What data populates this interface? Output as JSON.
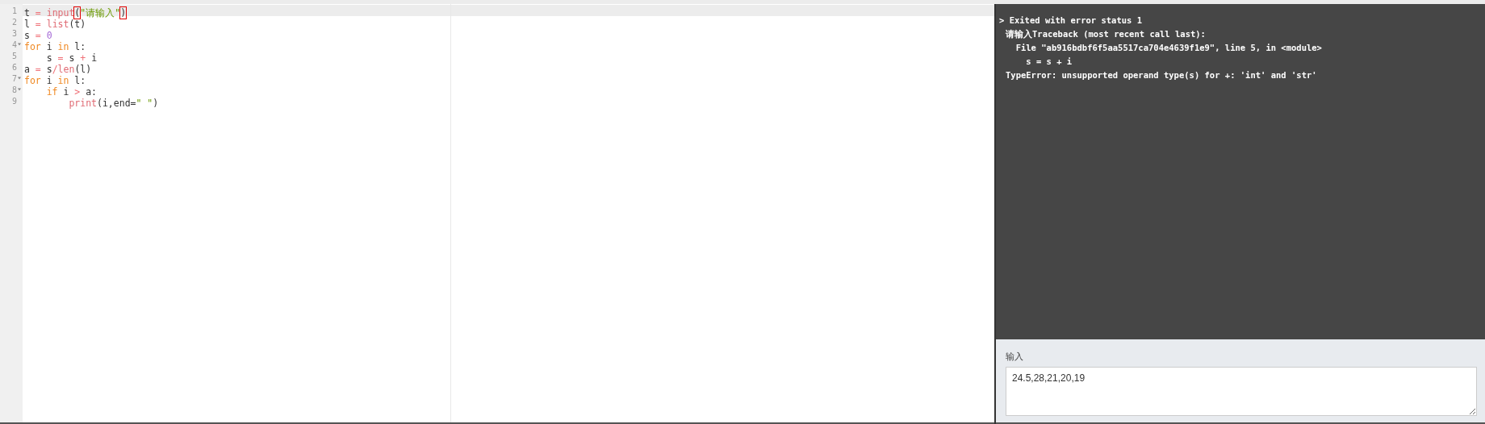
{
  "editor": {
    "lines": [
      {
        "number": "1",
        "active": true,
        "foldable": false,
        "tokens": [
          {
            "text": "t",
            "kind": "plain"
          },
          {
            "text": " = ",
            "kind": "operator"
          },
          {
            "text": "input",
            "kind": "builtin"
          },
          {
            "text": "(",
            "kind": "bracket-match"
          },
          {
            "text": "\"请输入\"",
            "kind": "string"
          },
          {
            "text": ")",
            "kind": "bracket-match"
          }
        ]
      },
      {
        "number": "2",
        "active": false,
        "foldable": false,
        "tokens": [
          {
            "text": "l",
            "kind": "plain"
          },
          {
            "text": " = ",
            "kind": "operator"
          },
          {
            "text": "list",
            "kind": "builtin"
          },
          {
            "text": "(t)",
            "kind": "plain"
          }
        ]
      },
      {
        "number": "3",
        "active": false,
        "foldable": false,
        "tokens": [
          {
            "text": "s",
            "kind": "plain"
          },
          {
            "text": " = ",
            "kind": "operator"
          },
          {
            "text": "0",
            "kind": "number"
          }
        ]
      },
      {
        "number": "4",
        "active": false,
        "foldable": true,
        "tokens": [
          {
            "text": "for",
            "kind": "keyword"
          },
          {
            "text": " i ",
            "kind": "plain"
          },
          {
            "text": "in",
            "kind": "keyword"
          },
          {
            "text": " l:",
            "kind": "plain"
          }
        ]
      },
      {
        "number": "5",
        "active": false,
        "foldable": false,
        "tokens": [
          {
            "text": "    s",
            "kind": "plain"
          },
          {
            "text": " = ",
            "kind": "operator"
          },
          {
            "text": "s",
            "kind": "plain"
          },
          {
            "text": " + ",
            "kind": "operator"
          },
          {
            "text": "i",
            "kind": "plain"
          }
        ]
      },
      {
        "number": "6",
        "active": false,
        "foldable": false,
        "tokens": [
          {
            "text": "a",
            "kind": "plain"
          },
          {
            "text": " = ",
            "kind": "operator"
          },
          {
            "text": "s",
            "kind": "plain"
          },
          {
            "text": "/",
            "kind": "operator"
          },
          {
            "text": "len",
            "kind": "builtin"
          },
          {
            "text": "(l)",
            "kind": "plain"
          }
        ]
      },
      {
        "number": "7",
        "active": false,
        "foldable": true,
        "tokens": [
          {
            "text": "for",
            "kind": "keyword"
          },
          {
            "text": " i ",
            "kind": "plain"
          },
          {
            "text": "in",
            "kind": "keyword"
          },
          {
            "text": " l:",
            "kind": "plain"
          }
        ]
      },
      {
        "number": "8",
        "active": false,
        "foldable": true,
        "tokens": [
          {
            "text": "    if",
            "kind": "keyword"
          },
          {
            "text": " i ",
            "kind": "plain"
          },
          {
            "text": ">",
            "kind": "operator"
          },
          {
            "text": " a:",
            "kind": "plain"
          }
        ]
      },
      {
        "number": "9",
        "active": false,
        "foldable": false,
        "tokens": [
          {
            "text": "        print",
            "kind": "builtin"
          },
          {
            "text": "(i,end=",
            "kind": "plain"
          },
          {
            "text": "\" \"",
            "kind": "string"
          },
          {
            "text": ")",
            "kind": "plain"
          }
        ]
      }
    ]
  },
  "console": {
    "lines": [
      {
        "text": "> Exited with error status 1",
        "kind": "status"
      },
      {
        "text": "请输入Traceback (most recent call last):",
        "kind": "output"
      },
      {
        "text": "  File \"ab916bdbf6f5aa5517ca704e4639f1e9\", line 5, in <module>",
        "kind": "output"
      },
      {
        "text": "    s = s + i",
        "kind": "output"
      },
      {
        "text": "TypeError: unsupported operand type(s) for +: 'int' and 'str'",
        "kind": "output"
      }
    ]
  },
  "input": {
    "label": "输入",
    "value": "24.5,28,21,20,19"
  }
}
